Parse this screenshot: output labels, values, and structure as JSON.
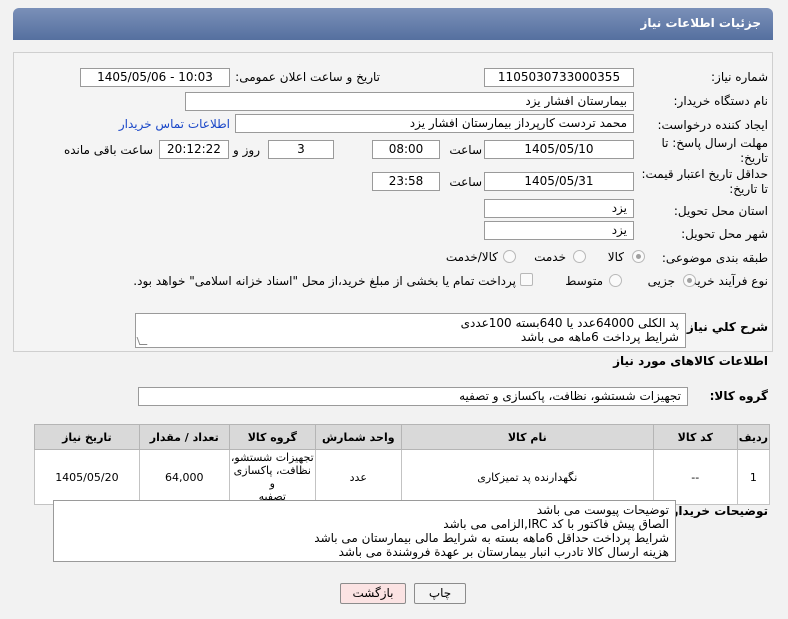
{
  "header": {
    "title": "جزئیات اطلاعات نیاز"
  },
  "form": {
    "need_number_label": "شماره نیاز:",
    "need_number": "1105030733000355",
    "announce_label": "تاریخ و ساعت اعلان عمومی:",
    "announce_value": "1405/05/06 - 10:03",
    "buyer_org_label": "نام دستگاه خریدار:",
    "buyer_org": "بیمارستان افشار یزد",
    "creator_label": "ایجاد کننده درخواست:",
    "creator": "محمد تردست کارپرداز بیمارستان افشار یزد",
    "contact_link": "اطلاعات تماس خریدار",
    "reply_deadline_label_1": "مهلت ارسال پاسخ: تا",
    "reply_deadline_label_2": "تاریخ:",
    "reply_date": "1405/05/10",
    "time_label": "ساعت",
    "reply_time": "08:00",
    "reply_days": "3",
    "days_and_label": "روز و",
    "remaining_time": "20:12:22",
    "remaining_label": "ساعت باقی مانده",
    "price_validity_label_1": "حداقل تاریخ اعتبار قیمت:",
    "price_validity_label_2": "تا تاریخ:",
    "validity_date": "1405/05/31",
    "validity_time": "23:58",
    "province_label": "استان محل تحویل:",
    "province": "یزد",
    "city_label": "شهر محل تحویل:",
    "city": "یزد",
    "category_label": "طبقه بندی موضوعی:",
    "category_goods": "کالا",
    "category_service": "خدمت",
    "category_both": "کالا/خدمت",
    "process_label": "نوع فرآیند خرید :",
    "process_partial": "جزیی",
    "process_medium": "متوسط",
    "payment_note": "پرداخت تمام یا بخشی از مبلغ خرید،از محل \"اسناد خزانه اسلامی\" خواهد بود."
  },
  "description": {
    "label": "شرح کلي نياز:",
    "line1": "پد الکلی 64000عدد یا 640بسته 100عددی",
    "line2": "شرایط پرداخت 6ماهه می باشد"
  },
  "goods_section": {
    "title": "اطلاعات کالاهای مورد نیاز",
    "group_label": "گروه کالا:",
    "group_value": "تجهیزات شستشو، نظافت، پاکسازی و تصفیه"
  },
  "table": {
    "headers": [
      "ردیف",
      "کد کالا",
      "نام کالا",
      "واحد شمارش",
      "گروه کالا",
      "تعداد / مقدار",
      "تاریخ نیاز"
    ],
    "rows": [
      {
        "row": "1",
        "code": "--",
        "name": "نگهدارنده پد تمیزکاری",
        "unit": "عدد",
        "group_1": "تجهیزات شستشو،",
        "group_2": "نظافت، پاکسازی و",
        "group_3": "تصفیه",
        "qty": "64,000",
        "date": "1405/05/20"
      }
    ]
  },
  "buyer_notes": {
    "label": "توضیحات خریدار:",
    "line1": "توضیحات پیوست می باشد",
    "line2": "الصاق پیش فاکتور با کد  IRC,الزامی می باشد",
    "line3": "شرایط پرداخت حداقل 6ماهه بسته به شرایط مالی بیمارستان می باشد",
    "line4": "هزینه ارسال کالا تادرب انبار بیمارستان بر عهدة فروشندة می باشد"
  },
  "buttons": {
    "print": "چاپ",
    "back": "بازگشت"
  },
  "colors": {
    "title_bar": "#5f7aa8",
    "link": "#1a47c8",
    "back_button_bg": "#fbe3e3"
  }
}
